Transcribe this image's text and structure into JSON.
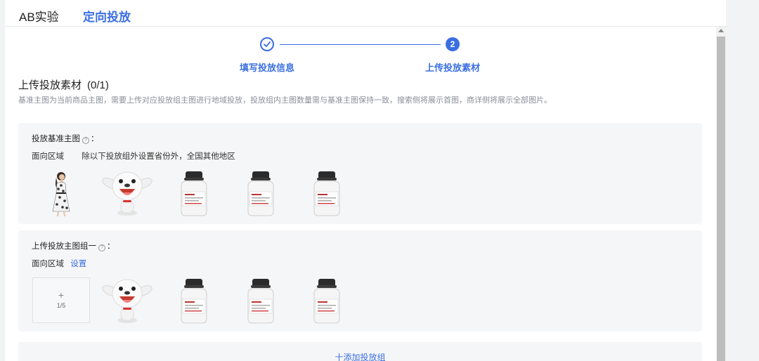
{
  "tabs": [
    {
      "label": "AB实验",
      "active": false
    },
    {
      "label": "定向投放",
      "active": true
    }
  ],
  "steps": [
    {
      "number": "",
      "label": "填写投放信息",
      "status": "done",
      "icon": "check-icon"
    },
    {
      "number": "2",
      "label": "上传投放素材",
      "status": "current"
    }
  ],
  "section": {
    "title": "上传投放素材",
    "count": "(0/1)",
    "description": "基准主图为当前商品主图，需要上传对应投放组主图进行地域投放，投放组内主图数量需与基准主图保持一致，搜索侧将展示首图，商详侧将展示全部图片。"
  },
  "base_group": {
    "title": "投放基准主图",
    "colon": "：",
    "region_label": "面向区域",
    "region_value": "除以下投放组外设置省份外，全国其他地区",
    "images": [
      "woman-dress-photo",
      "mascot-dog-photo",
      "white-bottle-photo",
      "white-bottle-photo",
      "white-bottle-photo"
    ]
  },
  "upload_group": {
    "title": "上传投放主图组一",
    "colon": "：",
    "region_label": "面向区域",
    "region_link": "设置",
    "upload_plus": "+",
    "upload_count": "1/5",
    "images": [
      "mascot-dog-photo",
      "white-bottle-photo",
      "white-bottle-photo",
      "white-bottle-photo"
    ]
  },
  "add_group_label": "十添加投放组",
  "colors": {
    "accent": "#3b6fe0",
    "card_bg": "#f5f6f7",
    "muted_text": "#8a8f99"
  }
}
